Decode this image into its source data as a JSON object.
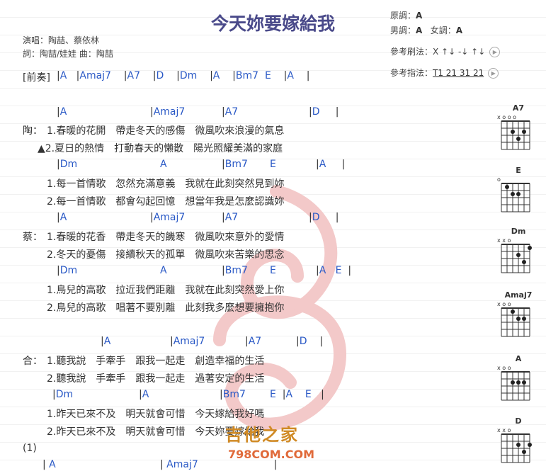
{
  "title": "今天妳要嫁給我",
  "singer": "演唱：陶喆、蔡依林",
  "credits": "詞：陶喆/娃娃   曲：陶喆",
  "keys": {
    "original_label": "原調：",
    "original": "A",
    "male_label": "男調：",
    "male": "A",
    "female_label": "女調：",
    "female": "A"
  },
  "strum": {
    "label": "參考刷法：",
    "value": "X ↑↓ -↓ ↑↓"
  },
  "pick": {
    "label": "參考指法：",
    "value": "T1 21 31 21"
  },
  "prelude": {
    "tag": "[前奏]",
    "chords": [
      "A",
      "Amaj7",
      "A7",
      "D",
      "Dm",
      "A",
      "Bm7",
      "E",
      "A"
    ]
  },
  "sections": {
    "tao_label": "陶：",
    "cai_label": "蔡：",
    "he_label": "合：",
    "tao_chords1": [
      "A",
      "Amaj7",
      "A7",
      "D"
    ],
    "tao_lyric1": "1.春暖的花開　帶走冬天的感傷　微風吹來浪漫的氣息",
    "tao_lyric2": "▲2.夏日的熱情　打動春天的懶散　陽光照耀美滿的家庭",
    "tao_chords2": [
      "Dm",
      "A",
      "Bm7",
      "E",
      "A"
    ],
    "tao_lyric3": "1.每一首情歌　忽然充滿意義　我就在此刻突然見到妳",
    "tao_lyric4": "2.每一首情歌　都會勾起回憶　想當年我是怎麼認識妳",
    "cai_chords1": [
      "A",
      "Amaj7",
      "A7",
      "D"
    ],
    "cai_lyric1": "1.春暖的花香　帶走冬天的饑寒　微風吹來意外的愛情",
    "cai_lyric2": "2.冬天的憂傷　接續秋天的孤單　微風吹來苦樂的思念",
    "cai_chords2": [
      "Dm",
      "A",
      "Bm7",
      "E",
      "A",
      "E"
    ],
    "cai_lyric3": "1.鳥兒的高歌　拉近我們距離　我就在此刻突然愛上你",
    "cai_lyric4": "2.鳥兒的高歌　唱著不要別離　此刻我多麼想要擁抱你",
    "he_chords1": [
      "A",
      "Amaj7",
      "A7",
      "D"
    ],
    "he_lyric1": "1.聽我說　手牽手　跟我一起走　創造幸福的生活",
    "he_lyric2": "2.聽我說　手牽手　跟我一起走　過著安定的生活",
    "he_chords2": [
      "Dm",
      "A",
      "Bm7",
      "E",
      "A",
      "E"
    ],
    "he_lyric3": "1.昨天已來不及　明天就會可惜　今天嫁給我好嗎",
    "he_lyric4": "2.昨天已來不及　明天就會可惜　今天妳要嫁給我",
    "ending_tag": "(1)",
    "ending_chords": [
      "A",
      "Amaj7"
    ]
  },
  "chord_diagrams": [
    {
      "name": "A7",
      "marks": "x o o o",
      "dots": [
        [
          1,
          1
        ],
        [
          1,
          3
        ],
        [
          2,
          2
        ]
      ]
    },
    {
      "name": "E",
      "marks": "o",
      "dots": [
        [
          0,
          0
        ],
        [
          1,
          1
        ],
        [
          1,
          2
        ]
      ]
    },
    {
      "name": "Dm",
      "marks": "x x o",
      "dots": [
        [
          0,
          4
        ],
        [
          1,
          2
        ],
        [
          2,
          3
        ]
      ]
    },
    {
      "name": "Amaj7",
      "marks": "x o o",
      "dots": [
        [
          0,
          1
        ],
        [
          1,
          2
        ],
        [
          1,
          3
        ]
      ]
    },
    {
      "name": "A",
      "marks": "x o o",
      "dots": [
        [
          1,
          1
        ],
        [
          1,
          2
        ],
        [
          1,
          3
        ]
      ]
    },
    {
      "name": "D",
      "marks": "x x o",
      "dots": [
        [
          1,
          2
        ],
        [
          1,
          4
        ],
        [
          2,
          3
        ]
      ]
    }
  ],
  "watermark": {
    "site_cn": "吉他之家",
    "site_en": "798COM.COM"
  },
  "colors": {
    "chord": "#2a59c6",
    "title": "#4a4a8a",
    "watermark": "#e04040"
  }
}
